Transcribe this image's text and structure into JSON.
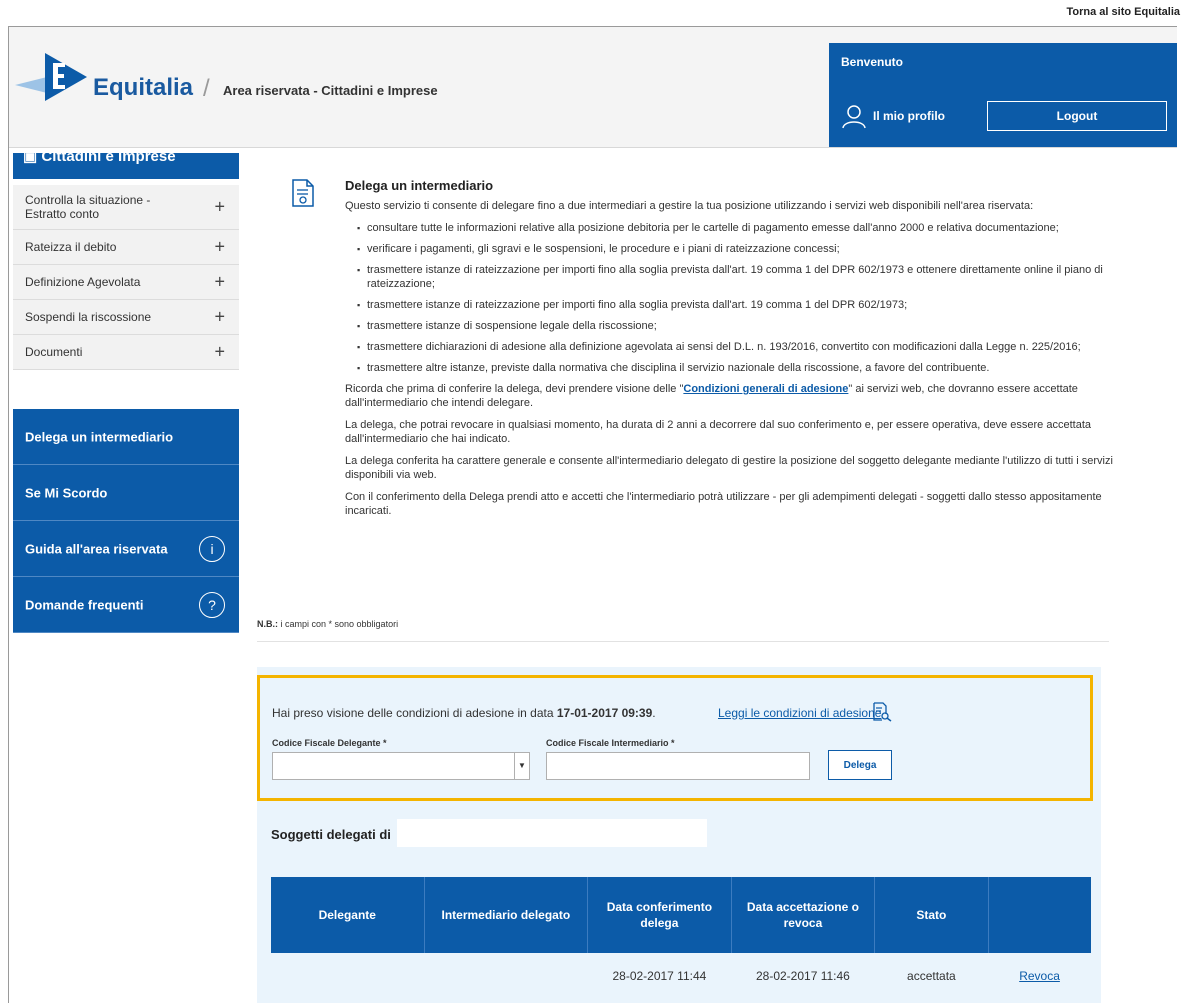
{
  "top_link": "Torna al sito Equitalia",
  "header": {
    "brand": "Equitalia",
    "slash": "/",
    "area_title": "Area riservata - Cittadini e Imprese",
    "welcome": "Benvenuto",
    "profile_label": "Il mio profilo",
    "logout_label": "Logout",
    "brand_color": "#1a5aa0",
    "accent_color": "#0c5ba8"
  },
  "sidebar": {
    "section_title": "Cittadini e Imprese",
    "accordion": [
      {
        "label": "Controlla la situazione - Estratto conto",
        "icon": "+"
      },
      {
        "label": "Rateizza il debito",
        "icon": "+"
      },
      {
        "label": "Definizione Agevolata",
        "icon": "+"
      },
      {
        "label": "Sospendi la riscossione",
        "icon": "+"
      },
      {
        "label": "Documenti",
        "icon": "+"
      }
    ],
    "blue_items": [
      {
        "label": "Delega un intermediario"
      },
      {
        "label": "Se Mi Scordo"
      },
      {
        "label": "Guida all'area riservata",
        "icon": "i",
        "icon_name": "info-icon"
      },
      {
        "label": "Domande frequenti",
        "icon": "?",
        "icon_name": "question-icon"
      }
    ]
  },
  "content": {
    "title": "Delega un intermediario",
    "intro": "Questo servizio ti consente di delegare fino a due intermediari a gestire la tua posizione utilizzando i servizi web disponibili nell'area riservata:",
    "bullets": [
      "consultare tutte le informazioni relative alla posizione debitoria per le cartelle di pagamento emesse dall'anno 2000 e relativa documentazione;",
      "verificare i pagamenti, gli sgravi e le sospensioni, le procedure e i piani di rateizzazione concessi;",
      "trasmettere istanze di rateizzazione per importi fino alla soglia prevista dall'art. 19 comma 1 del DPR 602/1973 e ottenere direttamente online il piano di rateizzazione;",
      "trasmettere istanze di rateizzazione per importi fino alla soglia prevista dall'art. 19 comma 1 del DPR 602/1973;",
      "trasmettere istanze di sospensione legale della riscossione;",
      "trasmettere dichiarazioni di adesione alla definizione agevolata ai sensi del D.L. n. 193/2016, convertito con modificazioni dalla Legge n. 225/2016;",
      "trasmettere altre istanze, previste dalla normativa che disciplina il servizio nazionale della riscossione, a favore del contribuente."
    ],
    "remember_before": "Ricorda che prima di conferire la delega, devi prendere visione delle \"",
    "remember_link": "Condizioni generali di adesione",
    "remember_after": "\" ai servizi web, che dovranno essere accettate dall'intermediario che intendi delegare.",
    "para_revoke": "La delega, che potrai revocare in qualsiasi momento, ha durata di 2 anni a decorrere dal suo conferimento e, per essere operativa, deve essere accettata dall'intermediario che hai indicato.",
    "para_general": "La delega conferita ha carattere generale e consente all'intermediario delegato di gestire la posizione del soggetto delegante mediante l'utilizzo di tutti i servizi disponibili via web.",
    "para_confirm": "Con il conferimento della Delega prendi atto e accetti che l'intermediario potrà utilizzare - per gli adempimenti delegati - soggetti dallo stesso appositamente incaricati.",
    "nb_bold": "N.B.:",
    "nb_text": " i campi con * sono obbligatori"
  },
  "form": {
    "conditions_text": "Hai preso visione delle condizioni di adesione in data ",
    "conditions_date": "17-01-2017 09:39",
    "conditions_dot": ".",
    "conditions_link": "Leggi le condizioni di adesione",
    "delegante_label": "Codice Fiscale Delegante *",
    "delegante_value": "",
    "intermediario_label": "Codice Fiscale Intermediario *",
    "intermediario_value": "",
    "submit_label": "Delega",
    "highlight_color": "#f4b400"
  },
  "table": {
    "title": "Soggetti delegati di",
    "headers": [
      "Delegante",
      "Intermediario delegato",
      "Data conferimento delega",
      "Data accettazione o revoca",
      "Stato",
      ""
    ],
    "rows": [
      {
        "delegante": "",
        "intermediario": "",
        "data_conferimento": "28-02-2017 11:44",
        "data_accettazione": "28-02-2017 11:46",
        "stato": "accettata",
        "action": "Revoca"
      }
    ]
  }
}
